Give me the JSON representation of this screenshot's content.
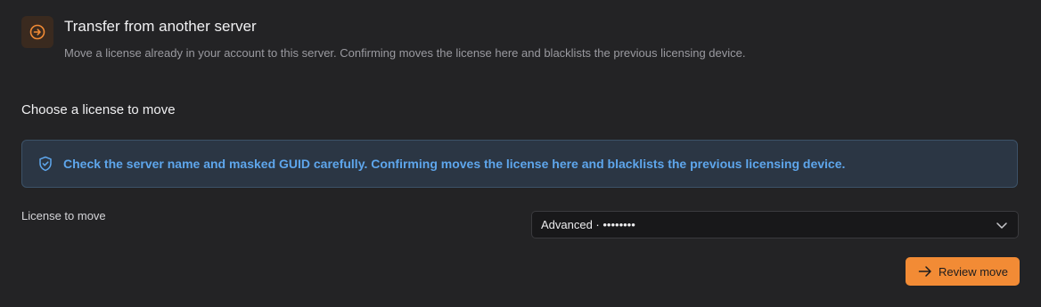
{
  "header": {
    "icon": "arrow-circle-right-icon",
    "title": "Transfer from another server",
    "description": "Move a license already in your account to this server. Confirming moves the license here and blacklists the previous licensing device."
  },
  "section": {
    "title": "Choose a license to move"
  },
  "alert": {
    "icon": "shield-check-icon",
    "message": "Check the server name and masked GUID carefully. Confirming moves the license here and blacklists the previous licensing device."
  },
  "license_field": {
    "label": "License to move",
    "selected_value": "Advanced · ••••••••",
    "icon": "chevron-down-icon"
  },
  "actions": {
    "review_label": "Review move",
    "review_icon": "arrow-right-icon"
  },
  "colors": {
    "background": "#232325",
    "accent": "#f28b35",
    "info": "#5ea6ec"
  }
}
